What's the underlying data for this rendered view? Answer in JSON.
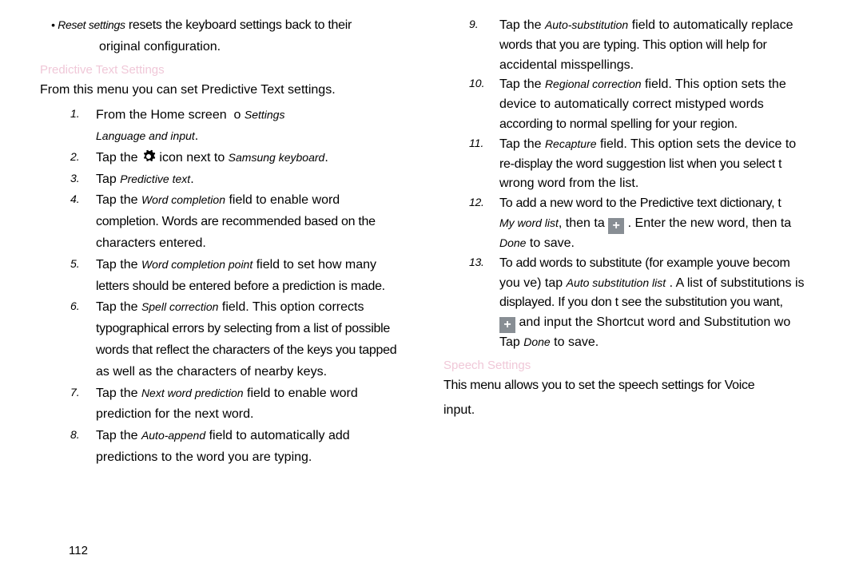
{
  "left": {
    "bullet_label": "• Reset settings",
    "bullet_text1": "resets the keyboard settings back to their",
    "bullet_text2": "original configuration.",
    "heading": "Predictive Text Settings",
    "intro": "From this menu you can set Predictive Text settings.",
    "s1a": "From the Home screen",
    "s1b": "o",
    "s1_settings": "Settings",
    "s1_lang": "Language and input",
    "s1_dot": ".",
    "s2a": "Tap the",
    "s2b": " icon next to",
    "s2_kb": "Samsung keyboard",
    "s2_dot": ".",
    "s3a": "Tap",
    "s3_pt": "Predictive text",
    "s3_dot": ".",
    "s4a": "Tap the",
    "s4_wc": "Word completion",
    "s4b": " field to enable word",
    "s4c": "completion. Words are recommended based on the",
    "s4d": "characters entered.",
    "s5a": "Tap the",
    "s5_wcp": "Word completion point",
    "s5b": " field to set how many",
    "s5c": "letters should be entered before a prediction is made.",
    "s6a": "Tap the",
    "s6_sc": "Spell correction",
    "s6b": " field. This option corrects",
    "s6c": "typographical errors by selecting from a list of possible",
    "s6d": "words that reflect the characters of the keys you tapped",
    "s6e": "as well as the characters of nearby keys.",
    "s7a": "Tap the",
    "s7_nwp": "Next word prediction",
    "s7b": " field to enable word",
    "s7c": "prediction for the next word.",
    "s8a": "Tap the",
    "s8_aa": "Auto-append",
    "s8b": " field to automatically add",
    "s8c": "predictions to the word you are typing."
  },
  "right": {
    "s9a": "Tap the",
    "s9_as": "Auto-substitution",
    "s9b": " field to automatically replace",
    "s9c": "words that you are typing. This option will help for",
    "s9d": "accidental misspellings.",
    "s10a": "Tap the",
    "s10_rc": "Regional correction",
    "s10b": " field. This option sets the",
    "s10c": "device to automatically correct mistyped words",
    "s10d": "according to normal spelling for your region.",
    "s11a": "Tap the",
    "s11_re": "Recapture",
    "s11b": " field. This option sets the device to",
    "s11c": "re-display the word suggestion list when you select t",
    "s11d": "wrong word from the list.",
    "s12a": "To add a new word to the Predictive text dictionary, t",
    "s12_mwl": "My word list",
    "s12b": ", then ta",
    "s12c": ". Enter the new word, then ta",
    "s12_done": "Done",
    "s12d": " to save.",
    "s13a": "To add words to substitute (for example youve becom",
    "s13b": "you ve) tap",
    "s13_asl": "Auto substitution list",
    "s13c": ". A list of substitutions is",
    "s13d": "displayed. If you don t see the substitution you want,",
    "s13e": " and input the Shortcut word and Substitution wo",
    "s13f": "Tap ",
    "s13_done": "Done",
    "s13g": " to save.",
    "heading2": "Speech Settings",
    "sp1": "This menu allows you to set the speech settings for Voice",
    "sp2": "input."
  },
  "pagenum": "112",
  "nums": {
    "n1": "1.",
    "n2": "2.",
    "n3": "3.",
    "n4": "4.",
    "n5": "5.",
    "n6": "6.",
    "n7": "7.",
    "n8": "8.",
    "n9": "9.",
    "n10": "10.",
    "n11": "11.",
    "n12": "12.",
    "n13": "13."
  }
}
